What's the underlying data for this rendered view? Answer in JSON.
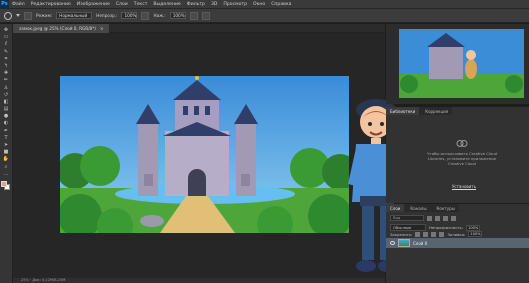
{
  "app": {
    "logo": "Ps"
  },
  "menu": [
    "Файл",
    "Редактирование",
    "Изображение",
    "Слои",
    "Текст",
    "Выделение",
    "Фильтр",
    "3D",
    "Просмотр",
    "Окно",
    "Справка"
  ],
  "options": {
    "mode_label": "Режим:",
    "mode_value": "Нормальный",
    "opacity_label": "Непрозр.:",
    "opacity_value": "100%",
    "flow_label": "Наж.:",
    "flow_value": "100%"
  },
  "document": {
    "tab_title": "замок.jpeg @ 25% (Слой 0, RGB/8*)",
    "close": "×",
    "status": "25% · Док: 4,12M/8,24M"
  },
  "tools": [
    "move-icon",
    "marquee-icon",
    "lasso-icon",
    "quick-select-icon",
    "crop-icon",
    "eyedropper-icon",
    "healing-icon",
    "brush-icon",
    "stamp-icon",
    "history-brush-icon",
    "eraser-icon",
    "gradient-icon",
    "blur-icon",
    "dodge-icon",
    "pen-icon",
    "type-icon",
    "path-select-icon",
    "shape-icon",
    "hand-icon",
    "zoom-icon",
    "more-icon"
  ],
  "colors": {
    "foreground": "#e9a07b",
    "background": "#ffffff",
    "accent_layer": "#596470"
  },
  "panels": {
    "libraries": {
      "tabs": [
        "Библиотеки",
        "Коррекция"
      ],
      "message": "Чтобы использовать Creative Cloud Libraries, установите приложение Creative Cloud",
      "install_link": "Установить"
    },
    "layers": {
      "tabs": [
        "Слои",
        "Каналы",
        "Контуры"
      ],
      "search_kind": "Вид",
      "blend_mode": "Обычные",
      "opacity_label": "Непрозрачность:",
      "opacity_value": "100%",
      "lock_label": "Закрепить:",
      "fill_label": "Заливка:",
      "fill_value": "100%",
      "layer_name": "Слой 0"
    }
  }
}
